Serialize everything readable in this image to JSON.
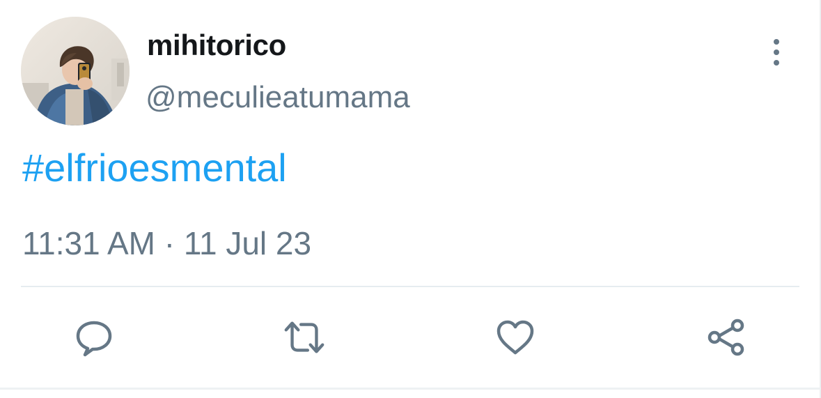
{
  "user": {
    "display_name": "mihitorico",
    "handle": "@meculieatumama"
  },
  "tweet": {
    "text": "#elfrioesmental",
    "timestamp": "11:31 AM · 11 Jul 23"
  },
  "actions": {
    "reply_icon": "reply-bubble-icon",
    "retweet_icon": "retweet-icon",
    "like_icon": "heart-icon",
    "share_icon": "share-icon",
    "more_icon": "more-vertical-icon"
  },
  "colors": {
    "text_primary": "#14171a",
    "text_secondary": "#657786",
    "link": "#1da1f2",
    "divider": "#e6ecf0"
  }
}
